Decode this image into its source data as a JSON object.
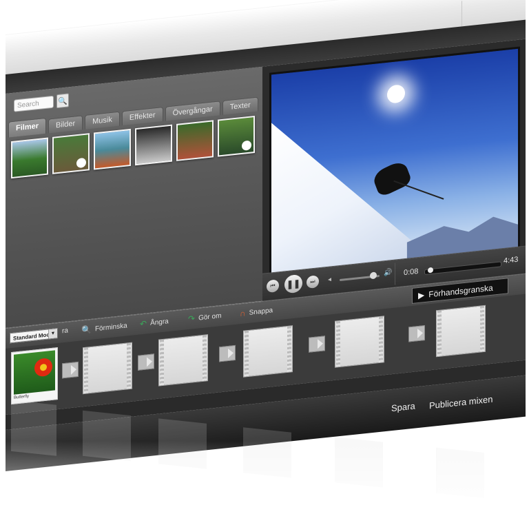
{
  "search": {
    "placeholder": "Search"
  },
  "library": {
    "tabs": [
      "Filmer",
      "Bilder",
      "Musik",
      "Effekter",
      "Övergångar",
      "Texter"
    ],
    "active_tab": "Filmer"
  },
  "player": {
    "time_current": "0:08",
    "time_total": "4:43",
    "progress": 0.03,
    "volume": 0.85
  },
  "toolbar": {
    "mode_label": "Standard Mode",
    "items": [
      {
        "label": "Förminska",
        "icon": "zoom-out-icon"
      },
      {
        "label": "Ångra",
        "icon": "undo-icon"
      },
      {
        "label": "Gör om",
        "icon": "redo-icon"
      },
      {
        "label": "Snappa",
        "icon": "magnet-icon"
      }
    ],
    "preview_label": "Förhandsgranska",
    "partial_label": "ra"
  },
  "timeline": {
    "clip_label": "Butterfly"
  },
  "footer": {
    "save_label": "Spara",
    "publish_label": "Publicera mixen"
  }
}
